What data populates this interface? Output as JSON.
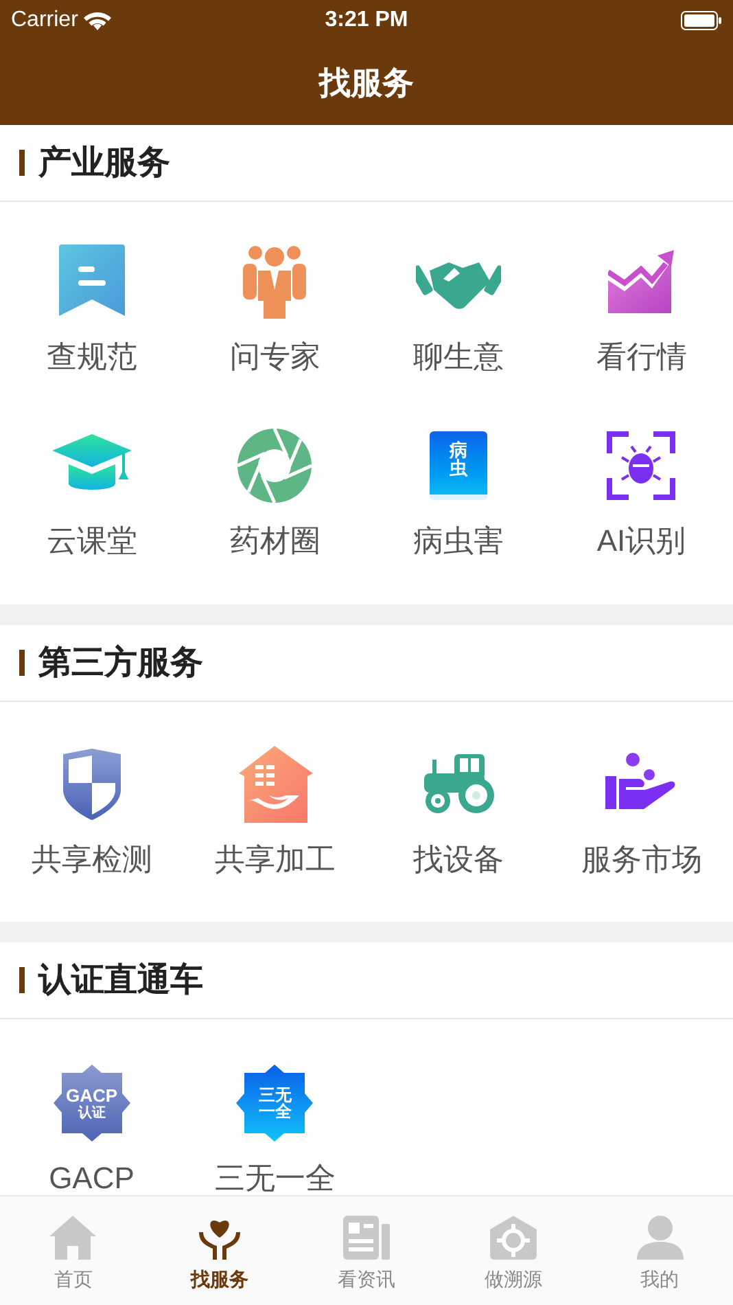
{
  "status_bar": {
    "carrier": "Carrier",
    "time": "3:21 PM"
  },
  "nav_bar": {
    "title": "找服务"
  },
  "sections": [
    {
      "title": "产业服务",
      "items": [
        {
          "label": "查规范"
        },
        {
          "label": "问专家"
        },
        {
          "label": "聊生意"
        },
        {
          "label": "看行情"
        },
        {
          "label": "云课堂"
        },
        {
          "label": "药材圈"
        },
        {
          "label": "病虫害",
          "badge_text": [
            "病",
            "虫"
          ]
        },
        {
          "label": "AI识别"
        }
      ]
    },
    {
      "title": "第三方服务",
      "items": [
        {
          "label": "共享检测"
        },
        {
          "label": "共享加工"
        },
        {
          "label": "找设备"
        },
        {
          "label": "服务市场"
        }
      ]
    },
    {
      "title": "认证直通车",
      "items": [
        {
          "label": "GACP",
          "badge_text": [
            "GACP",
            "认证"
          ]
        },
        {
          "label": "三无一全",
          "badge_text": [
            "三无",
            "一全"
          ]
        }
      ]
    }
  ],
  "tab_bar": [
    {
      "label": "首页",
      "selected": false
    },
    {
      "label": "找服务",
      "selected": true
    },
    {
      "label": "看资讯",
      "selected": false
    },
    {
      "label": "做溯源",
      "selected": false
    },
    {
      "label": "我的",
      "selected": false
    }
  ]
}
